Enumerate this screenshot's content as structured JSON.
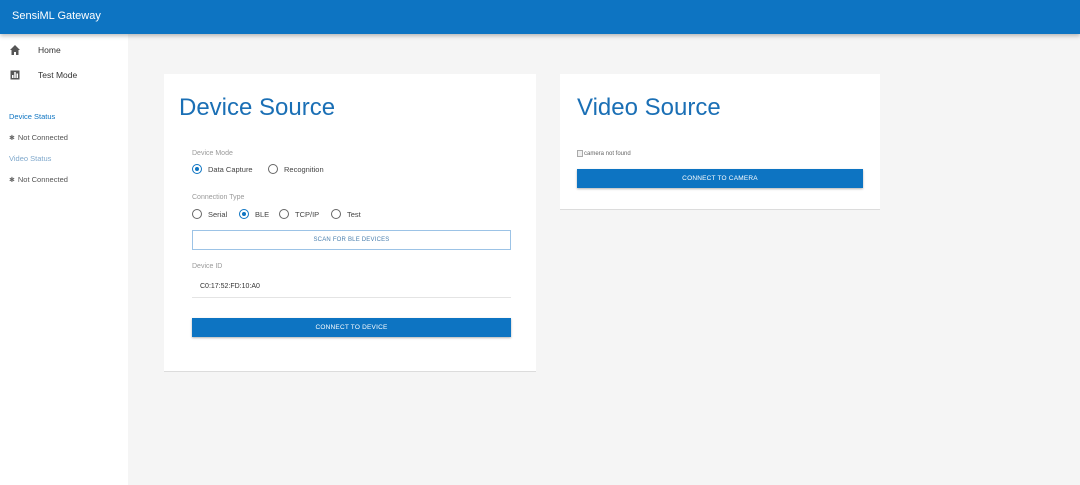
{
  "app": {
    "title": "SensiML Gateway"
  },
  "sidebar": {
    "items": [
      {
        "label": "Home",
        "icon": "home-icon"
      },
      {
        "label": "Test Mode",
        "icon": "test-mode-icon"
      }
    ],
    "device_status": {
      "heading": "Device Status",
      "text": "Not Connected"
    },
    "video_status": {
      "heading": "Video Status",
      "text": "Not Connected"
    }
  },
  "device_source": {
    "title": "Device Source",
    "device_mode": {
      "label": "Device Mode",
      "options": [
        "Data Capture",
        "Recognition"
      ],
      "selected": "Data Capture"
    },
    "connection_type": {
      "label": "Connection Type",
      "options": [
        "Serial",
        "BLE",
        "TCP/IP",
        "Test"
      ],
      "selected": "BLE"
    },
    "scan_button": "SCAN FOR BLE DEVICES",
    "device_id": {
      "label": "Device ID",
      "value": "C0:17:52:FD:10:A0"
    },
    "connect_button": "CONNECT TO DEVICE"
  },
  "video_source": {
    "title": "Video Source",
    "camera_alt": "camera not found",
    "connect_button": "CONNECT TO CAMERA"
  },
  "colors": {
    "primary": "#0d74c2",
    "title": "#1a6fb5",
    "background": "#f5f5f5"
  }
}
